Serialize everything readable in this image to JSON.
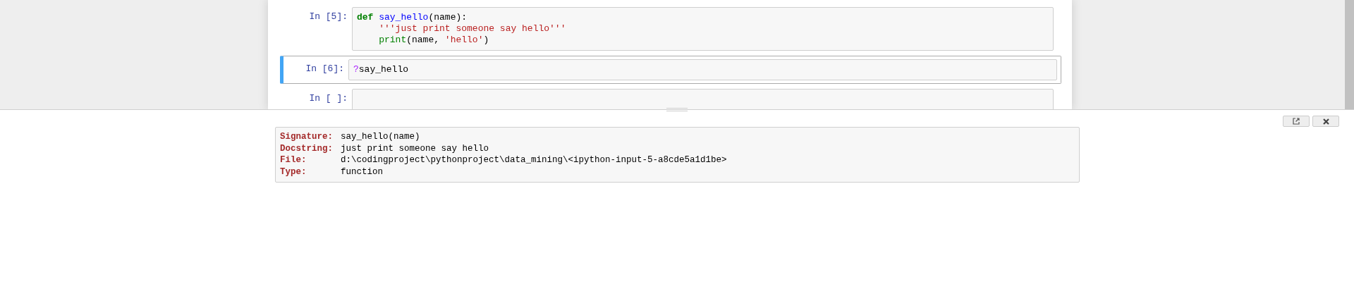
{
  "cells": [
    {
      "prompt": "In [5]:",
      "selected": false,
      "lines": [
        [
          {
            "text": "def",
            "kind": "keyword"
          },
          {
            "text": " say_hello",
            "kind": "def"
          },
          {
            "text": "(name):",
            "kind": "plain"
          }
        ],
        [
          {
            "text": "    '''just print someone say hello'''",
            "kind": "string"
          }
        ],
        [
          {
            "text": "    print",
            "kind": "builtin"
          },
          {
            "text": "(name, ",
            "kind": "plain"
          },
          {
            "text": "'hello'",
            "kind": "string"
          },
          {
            "text": ")",
            "kind": "plain"
          }
        ]
      ]
    },
    {
      "prompt": "In [6]:",
      "selected": true,
      "lines": [
        [
          {
            "text": "?",
            "kind": "operator"
          },
          {
            "text": "say_hello",
            "kind": "plain"
          }
        ]
      ]
    },
    {
      "prompt": "In [ ]:",
      "selected": false
    }
  ],
  "pager": {
    "fields": [
      {
        "label": "Signature:",
        "value": "say_hello(name)"
      },
      {
        "label": "Docstring:",
        "value": "just print someone say hello"
      },
      {
        "label": "File:",
        "value": "d:\\codingproject\\pythonproject\\data_mining\\<ipython-input-5-a8cde5a1d1be>"
      },
      {
        "label": "Type:",
        "value": "function"
      }
    ]
  }
}
